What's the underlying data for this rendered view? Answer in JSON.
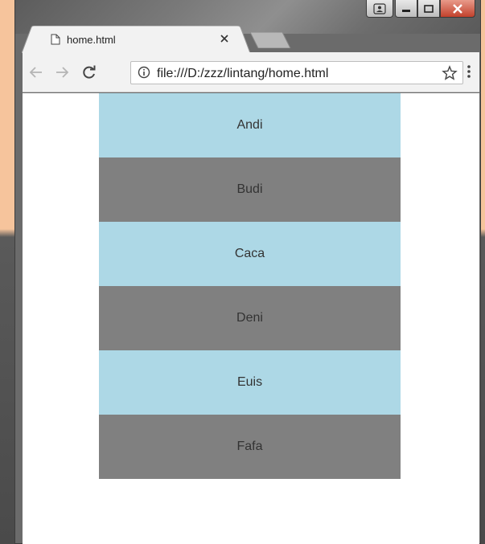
{
  "browser": {
    "tab_title": "home.html",
    "url": "file:///D:/zzz/lintang/home.html"
  },
  "colors": {
    "row_light": "#add8e6",
    "row_dark": "#808080",
    "toolbar_bg": "#f2f2f2",
    "page_bg": "#ffffff"
  },
  "icons": {
    "tab": "page-icon",
    "tab_close": "close-icon",
    "back": "back-arrow-icon",
    "forward": "forward-arrow-icon",
    "reload": "reload-icon",
    "info": "info-icon",
    "bookmark": "star-icon",
    "menu": "kebab-menu-icon"
  },
  "page": {
    "names": [
      "Andi",
      "Budi",
      "Caca",
      "Deni",
      "Euis",
      "Fafa"
    ]
  }
}
